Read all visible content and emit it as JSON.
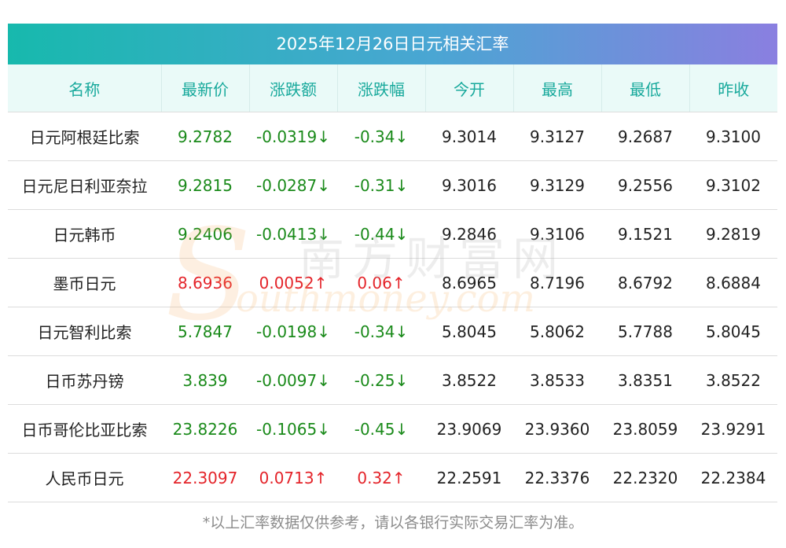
{
  "title": "2025年12月26日日元相关汇率",
  "headers": [
    "名称",
    "最新价",
    "涨跌额",
    "涨跌幅",
    "今开",
    "最高",
    "最低",
    "昨收"
  ],
  "rows": [
    {
      "name": "日元阿根廷比索",
      "latest": "9.2782",
      "change": "-0.0319↓",
      "pct": "-0.34↓",
      "open": "9.3014",
      "high": "9.3127",
      "low": "9.2687",
      "prev": "9.3100",
      "dir": "down"
    },
    {
      "name": "日元尼日利亚奈拉",
      "latest": "9.2815",
      "change": "-0.0287↓",
      "pct": "-0.31↓",
      "open": "9.3016",
      "high": "9.3129",
      "low": "9.2556",
      "prev": "9.3102",
      "dir": "down"
    },
    {
      "name": "日元韩币",
      "latest": "9.2406",
      "change": "-0.0413↓",
      "pct": "-0.44↓",
      "open": "9.2846",
      "high": "9.3106",
      "low": "9.1521",
      "prev": "9.2819",
      "dir": "down"
    },
    {
      "name": "墨币日元",
      "latest": "8.6936",
      "change": "0.0052↑",
      "pct": "0.06↑",
      "open": "8.6965",
      "high": "8.7196",
      "low": "8.6792",
      "prev": "8.6884",
      "dir": "up"
    },
    {
      "name": "日元智利比索",
      "latest": "5.7847",
      "change": "-0.0198↓",
      "pct": "-0.34↓",
      "open": "5.8045",
      "high": "5.8062",
      "low": "5.7788",
      "prev": "5.8045",
      "dir": "down"
    },
    {
      "name": "日币苏丹镑",
      "latest": "3.839",
      "change": "-0.0097↓",
      "pct": "-0.25↓",
      "open": "3.8522",
      "high": "3.8533",
      "low": "3.8351",
      "prev": "3.8522",
      "dir": "down"
    },
    {
      "name": "日币哥伦比亚比索",
      "latest": "23.8226",
      "change": "-0.1065↓",
      "pct": "-0.45↓",
      "open": "23.9069",
      "high": "23.9360",
      "low": "23.8059",
      "prev": "23.9291",
      "dir": "down"
    },
    {
      "name": "人民币日元",
      "latest": "22.3097",
      "change": "0.0713↑",
      "pct": "0.32↑",
      "open": "22.2591",
      "high": "22.3376",
      "low": "22.2320",
      "prev": "22.2384",
      "dir": "up"
    }
  ],
  "watermark": {
    "cn": "南方财富网",
    "en": "outhmoney.com",
    "s": "S"
  },
  "footnote": "*以上汇率数据仅供参考，请以各银行实际交易汇率为准。",
  "colors": {
    "up": "#e4242a",
    "down": "#1a8a1a",
    "header_text": "#18a99c"
  }
}
